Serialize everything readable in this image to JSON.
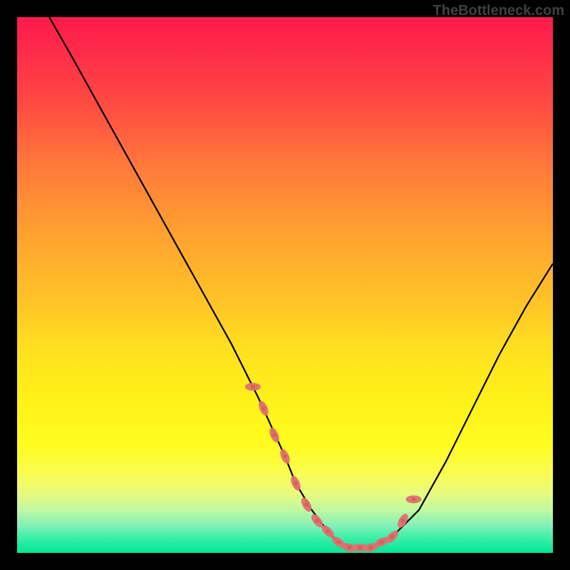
{
  "watermark": "TheBottleneck.com",
  "chart_data": {
    "type": "line",
    "title": "",
    "xlabel": "",
    "ylabel": "",
    "xlim": [
      0,
      100
    ],
    "ylim": [
      0,
      100
    ],
    "background_gradient": {
      "top_color": "#ff1a4a",
      "mid_color": "#ffe020",
      "bottom_color": "#00e898",
      "meaning": "bottleneck severity (red=high, green=low)"
    },
    "series": [
      {
        "name": "bottleneck-curve",
        "color": "#000000",
        "x": [
          6,
          10,
          15,
          20,
          25,
          30,
          35,
          40,
          45,
          50,
          52,
          55,
          58,
          60,
          63,
          66,
          70,
          75,
          80,
          85,
          90,
          95,
          100
        ],
        "y": [
          100,
          93,
          84,
          75,
          66,
          57,
          48,
          39,
          29,
          18,
          13,
          8,
          4,
          2,
          1,
          1,
          3,
          8,
          17,
          27,
          37,
          46,
          54
        ]
      },
      {
        "name": "highlight-markers",
        "color": "#e46a6a",
        "type": "scatter",
        "x": [
          44,
          46,
          48,
          50,
          52,
          54,
          56,
          58,
          60,
          62,
          64,
          66,
          68,
          70,
          72,
          74
        ],
        "y": [
          31,
          27,
          22,
          18,
          13,
          9,
          6,
          4,
          2,
          1,
          1,
          1,
          2,
          3,
          6,
          10
        ]
      }
    ]
  }
}
